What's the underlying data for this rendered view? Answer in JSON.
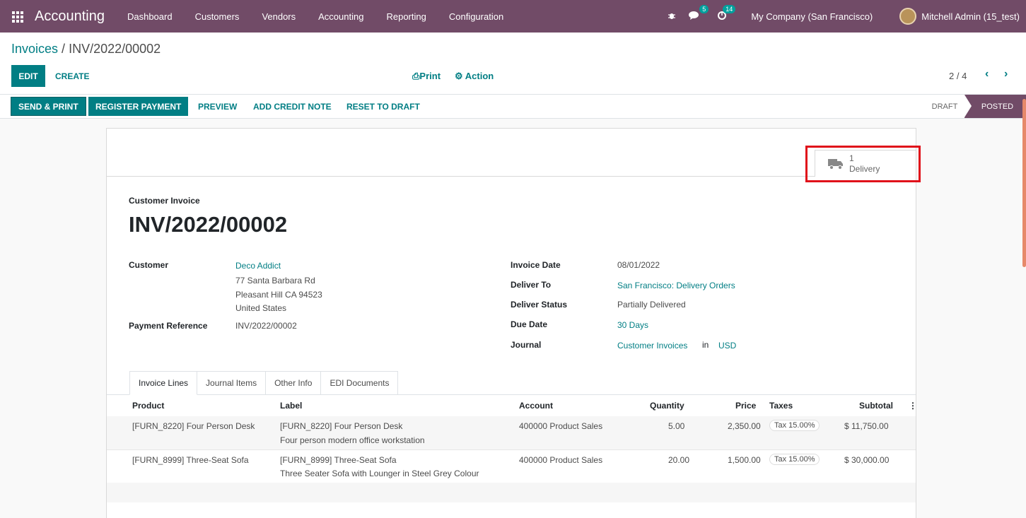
{
  "navbar": {
    "app_name": "Accounting",
    "menu": [
      "Dashboard",
      "Customers",
      "Vendors",
      "Accounting",
      "Reporting",
      "Configuration"
    ],
    "messages_count": "5",
    "activities_count": "14",
    "company": "My Company (San Francisco)",
    "user": "Mitchell Admin (15_test)"
  },
  "breadcrumb": {
    "parent": "Invoices",
    "separator": " / ",
    "current": "INV/2022/00002"
  },
  "control": {
    "edit_label": "EDIT",
    "create_label": "CREATE",
    "print_label": "Print",
    "action_label": "Action",
    "pager": "2 / 4"
  },
  "statusbar": {
    "buttons": [
      "SEND & PRINT",
      "REGISTER PAYMENT",
      "PREVIEW",
      "ADD CREDIT NOTE",
      "RESET TO DRAFT"
    ],
    "stages": [
      "DRAFT",
      "POSTED"
    ],
    "active_stage": "POSTED"
  },
  "smart_button": {
    "count": "1",
    "label": "Delivery"
  },
  "invoice": {
    "type": "Customer Invoice",
    "name": "INV/2022/00002",
    "customer_label": "Customer",
    "customer_name": "Deco Addict",
    "address_line1": "77 Santa Barbara Rd",
    "address_line2": "Pleasant Hill CA 94523",
    "address_line3": "United States",
    "payment_ref_label": "Payment Reference",
    "payment_ref": "INV/2022/00002",
    "invoice_date_label": "Invoice Date",
    "invoice_date": "08/01/2022",
    "deliver_to_label": "Deliver To",
    "deliver_to": "San Francisco: Delivery Orders",
    "deliver_status_label": "Deliver Status",
    "deliver_status": "Partially Delivered",
    "due_date_label": "Due Date",
    "due_date": "30 Days",
    "journal_label": "Journal",
    "journal": "Customer Invoices",
    "journal_in": "in",
    "currency": "USD"
  },
  "tabs": [
    "Invoice Lines",
    "Journal Items",
    "Other Info",
    "EDI Documents"
  ],
  "lines": {
    "headers": [
      "Product",
      "Label",
      "Account",
      "Quantity",
      "Price",
      "Taxes",
      "Subtotal"
    ],
    "rows": [
      {
        "product": "[FURN_8220] Four Person Desk",
        "label1": "[FURN_8220] Four Person Desk",
        "label2": "Four person modern office workstation",
        "account": "400000 Product Sales",
        "quantity": "5.00",
        "price": "2,350.00",
        "tax": "Tax 15.00%",
        "subtotal": "$ 11,750.00"
      },
      {
        "product": "[FURN_8999] Three-Seat Sofa",
        "label1": "[FURN_8999] Three-Seat Sofa",
        "label2": "Three Seater Sofa with Lounger in Steel Grey Colour",
        "account": "400000 Product Sales",
        "quantity": "20.00",
        "price": "1,500.00",
        "tax": "Tax 15.00%",
        "subtotal": "$ 30,000.00"
      }
    ]
  },
  "colors": {
    "brand": "#714b67",
    "accent": "#017e84",
    "highlight": "#e0101a"
  }
}
